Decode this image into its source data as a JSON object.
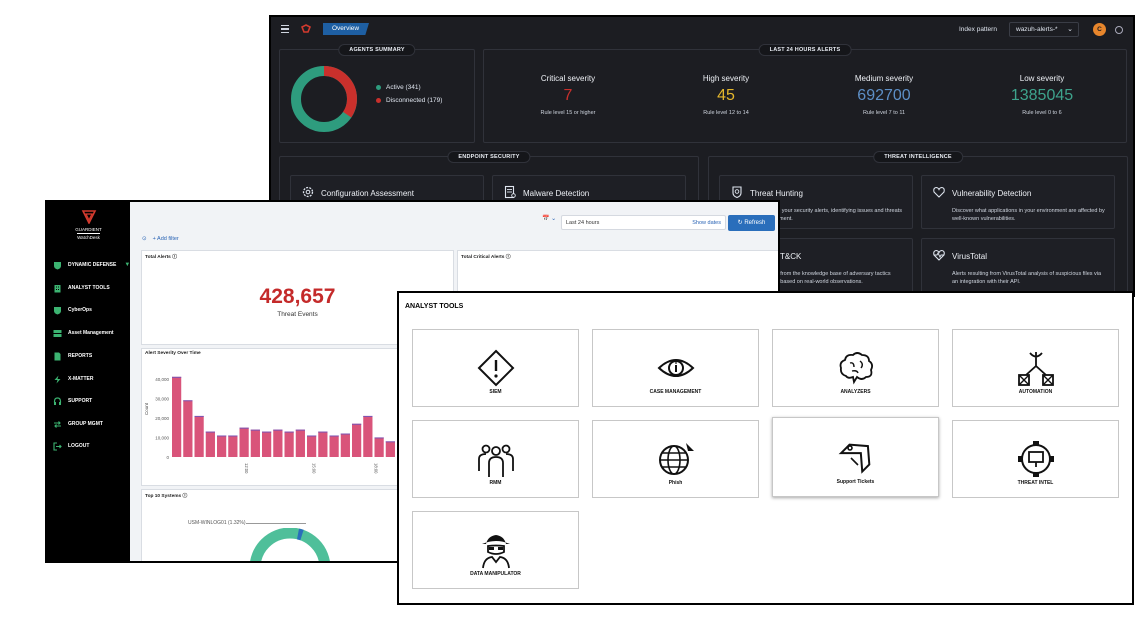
{
  "dark": {
    "tab": "Overview",
    "index_label": "Index pattern",
    "index_value": "wazuh-alerts-*",
    "avatar_letter": "C",
    "agents": {
      "title": "AGENTS SUMMARY",
      "active": "Active (341)",
      "disconnected": "Disconnected (179)",
      "active_count": 341,
      "disconnected_count": 179,
      "active_color": "#2e9c7e",
      "disconnected_color": "#c9302c"
    },
    "alerts": {
      "title": "LAST 24 HOURS ALERTS",
      "items": [
        {
          "label": "Critical severity",
          "value": "7",
          "rule": "Rule level 15 or higher",
          "color": "#c9302c"
        },
        {
          "label": "High severity",
          "value": "45",
          "rule": "Rule level 12 to 14",
          "color": "#e3b62c"
        },
        {
          "label": "Medium severity",
          "value": "692700",
          "rule": "Rule level 7 to 11",
          "color": "#5d8fc6"
        },
        {
          "label": "Low severity",
          "value": "1385045",
          "rule": "Rule level 0 to 6",
          "color": "#3ea38c"
        }
      ]
    },
    "endpoint": {
      "title": "ENDPOINT SECURITY",
      "cards": [
        {
          "title": "Configuration Assessment",
          "desc": ""
        },
        {
          "title": "Malware Detection",
          "desc": ""
        }
      ]
    },
    "threat": {
      "title": "THREAT INTELLIGENCE",
      "cards": [
        {
          "title": "Threat Hunting",
          "desc": "in your security alerts, identifying issues and threats",
          "desc2": "nment."
        },
        {
          "title": "Vulnerability Detection",
          "desc": "Discover what applications in your environment are affected by well-known vulnerabilities."
        },
        {
          "title": "T&CK",
          "desc": "s from the knowledge base of adversary tactics",
          "desc2": "s based on real-world observations."
        },
        {
          "title": "VirusTotal",
          "desc": "Alerts resulting from VirusTotal analysis of suspicious files via an integration with their API."
        }
      ]
    }
  },
  "light": {
    "brand1": "GUARDIENT",
    "brand2": "WatchDesk",
    "nav": [
      {
        "label": "DYNAMIC DEFENSE"
      },
      {
        "label": "ANALYST TOOLS"
      },
      {
        "label": "CyberOps"
      },
      {
        "label": "Asset Management"
      },
      {
        "label": "REPORTS"
      },
      {
        "label": "X-MATTER"
      },
      {
        "label": "SUPPORT"
      },
      {
        "label": "GROUP MGMT"
      },
      {
        "label": "LOGOUT"
      }
    ],
    "time_range": "Last 24 hours",
    "show_dates": "Show dates",
    "refresh": "Refresh",
    "add_filter": "+ Add filter",
    "total_alerts_title": "Total Alerts",
    "total_alerts_value": "428,657",
    "total_alerts_sub": "Threat Events",
    "total_critical_title": "Total Critical Alerts",
    "severity_title": "Alert Severity Over Time",
    "top_systems_title": "Top 10 Systems",
    "top_system_label": "USM-WINLOG01 (1.32%)",
    "chart_data": {
      "type": "bar",
      "title": "Alert Severity Over Time",
      "ylabel": "Count",
      "ylim": [
        0,
        45000
      ],
      "ytick_labels": [
        "0",
        "10,000",
        "20,000",
        "30,000",
        "40,000"
      ],
      "xtick_labels": [
        "12:00",
        "15:00",
        "18:00"
      ],
      "values": [
        41000,
        29000,
        21000,
        13000,
        11000,
        11000,
        15000,
        14000,
        13000,
        14000,
        13000,
        14000,
        11000,
        13000,
        11000,
        12000,
        17000,
        21000,
        10000,
        8000,
        10000,
        11000,
        7000,
        5000
      ],
      "color": "#d9547a"
    }
  },
  "tools": {
    "title": "ANALYST TOOLS",
    "items": [
      {
        "label": "SIEM"
      },
      {
        "label": "CASE MANAGEMENT"
      },
      {
        "label": "ANALYZERS"
      },
      {
        "label": "AUTOMATION"
      },
      {
        "label": "RMM"
      },
      {
        "label": "Phish"
      },
      {
        "label": "Support Tickets"
      },
      {
        "label": "THREAT INTEL"
      },
      {
        "label": "DATA MANIPULATOR"
      }
    ]
  }
}
